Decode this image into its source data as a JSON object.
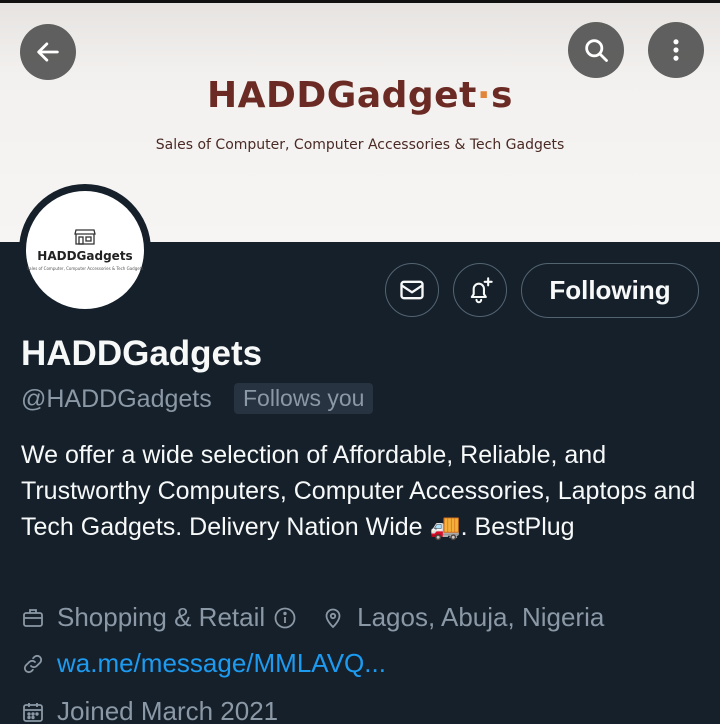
{
  "banner": {
    "logo_main": "HADDGadget",
    "logo_dot": "·",
    "logo_end": "s",
    "tagline": "Sales of Computer, Computer Accessories & Tech Gadgets"
  },
  "avatar": {
    "name": "HADDGadgets",
    "subtitle": "Sales of Computer, Computer Accessories & Tech Gadgets"
  },
  "actions": {
    "following_label": "Following"
  },
  "profile": {
    "display_name": "HADDGadgets",
    "handle": "@HADDGadgets",
    "follows_you": "Follows you",
    "bio": "We offer a wide selection of Affordable, Reliable, and Trustworthy Computers, Computer Accessories, Laptops and Tech Gadgets. Delivery Nation Wide 🚚. BestPlug",
    "category": "Shopping & Retail",
    "location": "Lagos, Abuja, Nigeria",
    "website": "wa.me/message/MMLAVQ...",
    "joined": "Joined March 2021"
  },
  "icons": [
    "back-arrow-icon",
    "search-icon",
    "more-vertical-icon",
    "store-icon",
    "message-icon",
    "bell-plus-icon",
    "briefcase-icon",
    "info-icon",
    "location-pin-icon",
    "link-icon",
    "calendar-icon"
  ],
  "colors": {
    "background": "#15202b",
    "secondary_text": "#8b98a5",
    "link": "#1d9bf0",
    "border": "#536471"
  }
}
